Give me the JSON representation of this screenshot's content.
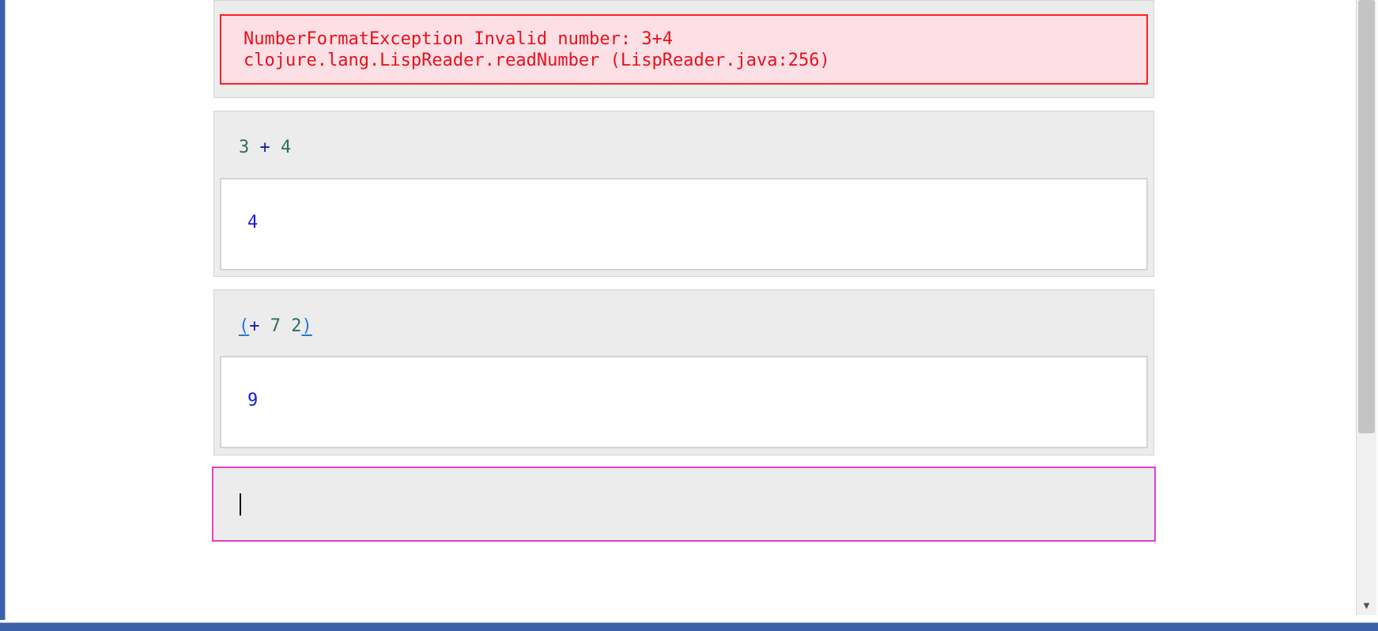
{
  "error": {
    "line1": "NumberFormatException Invalid number: 3+4",
    "line2": "clojure.lang.LispReader.readNumber (LispReader.java:256)"
  },
  "cells": [
    {
      "input_parts": [
        "3",
        " + ",
        "4"
      ],
      "output": "4"
    },
    {
      "input_parts": [
        "(",
        "+ ",
        "7",
        " ",
        "2",
        ")"
      ],
      "output": "9"
    }
  ],
  "new_input": {
    "value": ""
  },
  "colors": {
    "error_text": "#e8101a",
    "error_bg": "#fde0e6",
    "active_cell_border": "#e040c8",
    "result_text": "#1a1ae0"
  }
}
